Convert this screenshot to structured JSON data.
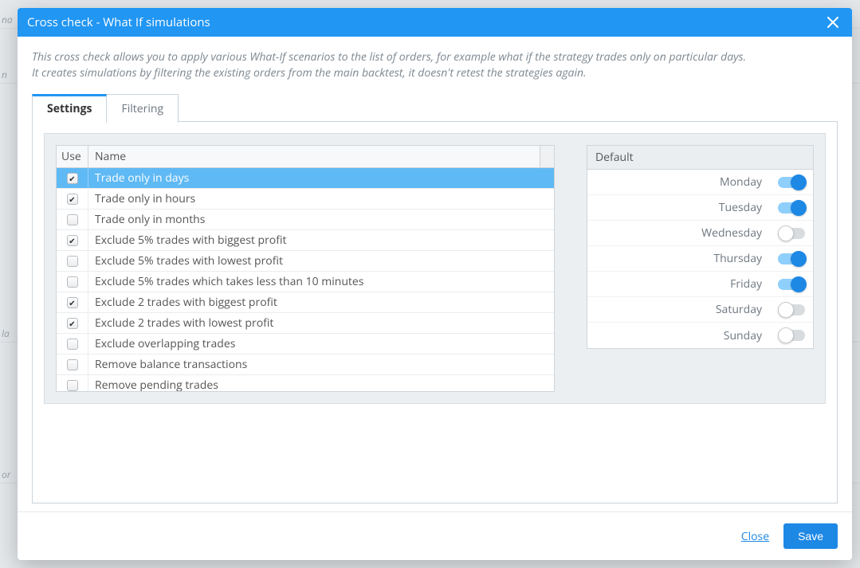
{
  "header": {
    "title": "Cross check - What If simulations"
  },
  "description": {
    "line1": "This cross check allows you to apply various What-If scenarios to the list of orders, for example what if the strategy trades only on particular days.",
    "line2": "It creates simulations by filtering the existing orders from the main backtest, it doesn't retest the strategies again."
  },
  "tabs": {
    "settings": "Settings",
    "filtering": "Filtering",
    "active": "settings"
  },
  "grid": {
    "headers": {
      "use": "Use",
      "name": "Name"
    },
    "rows": [
      {
        "checked": true,
        "selected": true,
        "label": "Trade only in days"
      },
      {
        "checked": true,
        "selected": false,
        "label": "Trade only in hours"
      },
      {
        "checked": false,
        "selected": false,
        "label": "Trade only in months"
      },
      {
        "checked": true,
        "selected": false,
        "label": "Exclude 5% trades with biggest profit"
      },
      {
        "checked": false,
        "selected": false,
        "label": "Exclude 5% trades with lowest profit"
      },
      {
        "checked": false,
        "selected": false,
        "label": "Exclude 5% trades which takes less than 10 minutes"
      },
      {
        "checked": true,
        "selected": false,
        "label": "Exclude 2 trades with biggest profit"
      },
      {
        "checked": true,
        "selected": false,
        "label": "Exclude 2 trades with lowest profit"
      },
      {
        "checked": false,
        "selected": false,
        "label": "Exclude overlapping trades"
      },
      {
        "checked": false,
        "selected": false,
        "label": "Remove balance transactions"
      },
      {
        "checked": false,
        "selected": false,
        "label": "Remove pending trades"
      }
    ]
  },
  "days": {
    "header": "Default",
    "items": [
      {
        "label": "Monday",
        "on": true
      },
      {
        "label": "Tuesday",
        "on": true
      },
      {
        "label": "Wednesday",
        "on": false
      },
      {
        "label": "Thursday",
        "on": true
      },
      {
        "label": "Friday",
        "on": true
      },
      {
        "label": "Saturday",
        "on": false
      },
      {
        "label": "Sunday",
        "on": false
      }
    ]
  },
  "footer": {
    "close": "Close",
    "save": "Save"
  }
}
